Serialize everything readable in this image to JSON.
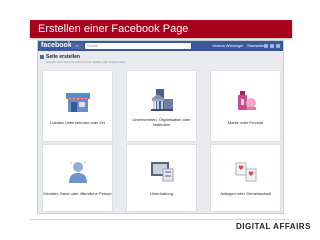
{
  "slide": {
    "title": "Erstellen einer Facebook Page",
    "brand": "DIGITAL AFFAIRS"
  },
  "facebook": {
    "logo": "facebook",
    "search_placeholder": "Suche",
    "user_name": "Verena Wiesinger",
    "home_label": "Startseite"
  },
  "page_header": {
    "title": "Seite erstellen",
    "subtitle": "Erstelle eine Seite für deine Firma, Marke oder Organisation."
  },
  "categories": [
    {
      "label": "Lokales Unternehmen oder Ort",
      "icon": "storefront-icon"
    },
    {
      "label": "Unternehmen, Organisation oder Institution",
      "icon": "institution-icon"
    },
    {
      "label": "Marke oder Produkt",
      "icon": "product-icon"
    },
    {
      "label": "Künstler, Band oder öffentliche Person",
      "icon": "person-icon"
    },
    {
      "label": "Unterhaltung",
      "icon": "entertainment-icon"
    },
    {
      "label": "Anliegen oder Gemeinschaft",
      "icon": "community-icon"
    }
  ],
  "colors": {
    "title_bar": "#a8001d",
    "facebook_blue": "#3b5998"
  }
}
